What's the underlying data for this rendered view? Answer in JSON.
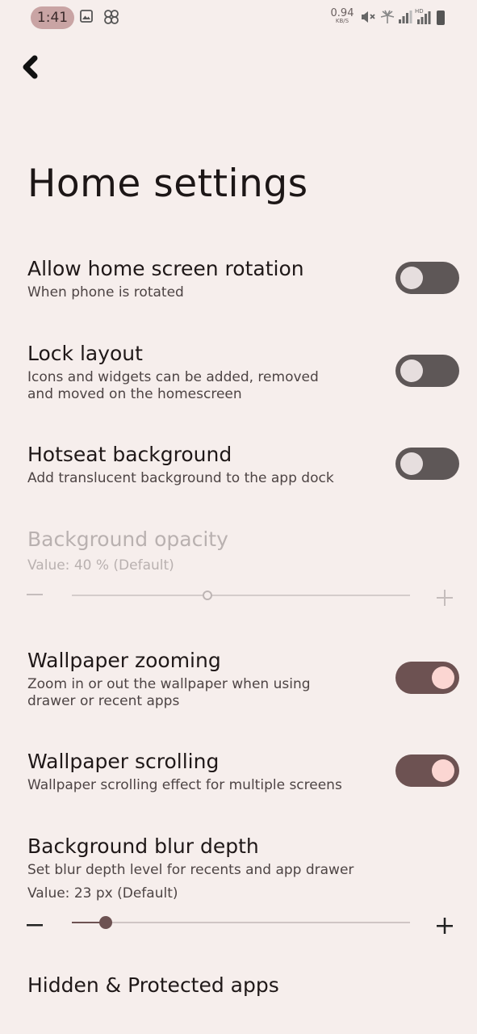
{
  "status_bar": {
    "time": "1:41",
    "net_speed_value": "0.94",
    "net_speed_unit": "KB/S",
    "network_type": "HD",
    "icons": [
      "gallery-icon",
      "pinwheel-icon",
      "mute-icon",
      "hotspot-icon",
      "signal-icon",
      "signal-hd-icon",
      "battery-icon"
    ]
  },
  "header": {
    "back_icon": "chevron-left-icon",
    "title": "Home settings"
  },
  "settings": {
    "rotation": {
      "title": "Allow home screen rotation",
      "subtitle": "When phone is rotated",
      "enabled": false
    },
    "lock_layout": {
      "title": "Lock layout",
      "subtitle_line1": "Icons and widgets can be added, removed",
      "subtitle_line2": "and moved on the homescreen",
      "enabled": false
    },
    "hotseat_bg": {
      "title": "Hotseat background",
      "subtitle": "Add translucent background to the app dock",
      "enabled": false
    },
    "bg_opacity": {
      "title": "Background opacity",
      "value_text": "Value: 40 % (Default)",
      "value": 40,
      "min_icon": "minus-icon",
      "max_icon": "plus-icon",
      "disabled": true
    },
    "wallpaper_zoom": {
      "title": "Wallpaper zooming",
      "subtitle_line1": "Zoom in or out the wallpaper when using",
      "subtitle_line2": "drawer or recent apps",
      "enabled": true
    },
    "wallpaper_scroll": {
      "title": "Wallpaper scrolling",
      "subtitle": "Wallpaper scrolling effect for multiple screens",
      "enabled": true
    },
    "blur_depth": {
      "title": "Background blur depth",
      "subtitle": "Set blur depth level for recents and app drawer",
      "value_text": "Value: 23 px (Default)",
      "value_fraction": 0.1
    },
    "hidden_apps": {
      "title": "Hidden & Protected apps"
    }
  },
  "colors": {
    "background": "#f6eeec",
    "toggle_off": "#5e5757",
    "toggle_on": "#6d5252",
    "knob_on": "#fbd6d2",
    "accent": "#6d5252"
  }
}
